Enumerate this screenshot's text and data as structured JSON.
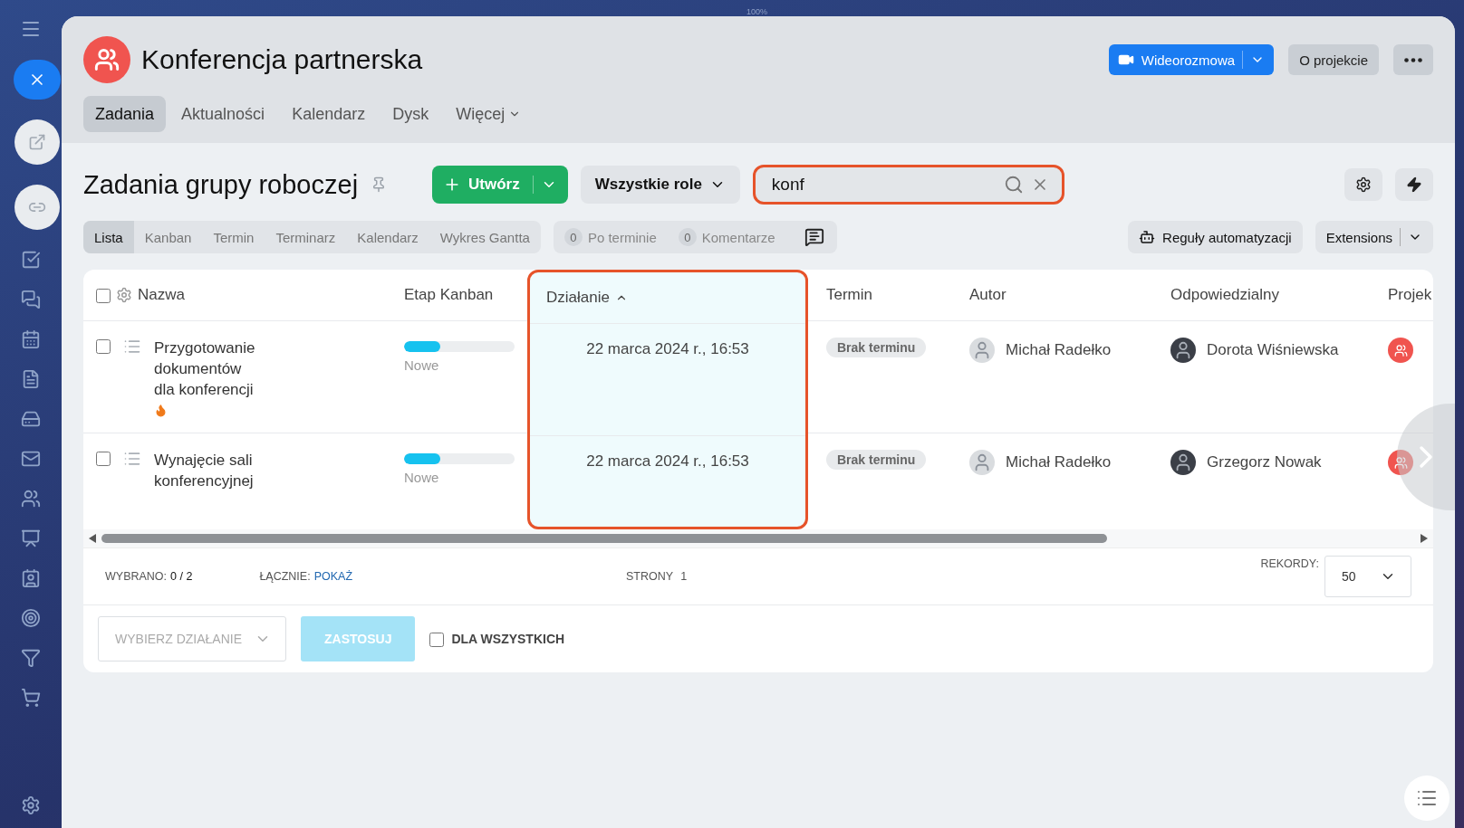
{
  "zoom_label": "100%",
  "project": {
    "title": "Konferencja partnerska"
  },
  "header_buttons": {
    "video": "Wideorozmowa",
    "about": "O projekcie"
  },
  "nav_tabs": [
    {
      "label": "Zadania",
      "selected": true,
      "kind": "link"
    },
    {
      "label": "Aktualności",
      "selected": false,
      "kind": "link"
    },
    {
      "label": "Kalendarz",
      "selected": false,
      "kind": "link"
    },
    {
      "label": "Dysk",
      "selected": false,
      "kind": "link"
    },
    {
      "label": "Więcej",
      "selected": false,
      "kind": "menu"
    }
  ],
  "page_title": "Zadania grupy roboczej",
  "create_button": "Utwórz",
  "role_filter": "Wszystkie role",
  "search": {
    "value": "konf",
    "highlighted": true
  },
  "views": [
    {
      "label": "Lista",
      "selected": true
    },
    {
      "label": "Kanban",
      "selected": false
    },
    {
      "label": "Termin",
      "selected": false
    },
    {
      "label": "Terminarz",
      "selected": false
    },
    {
      "label": "Kalendarz",
      "selected": false
    },
    {
      "label": "Wykres Gantta",
      "selected": false
    }
  ],
  "counters": [
    {
      "count": "0",
      "label": "Po terminie"
    },
    {
      "count": "0",
      "label": "Komentarze"
    }
  ],
  "automation_button": "Reguły automatyzacji",
  "extensions_button": "Extensions",
  "table": {
    "all_checked": false,
    "columns": [
      {
        "label": "Nazwa",
        "sorted": false,
        "highlighted": false
      },
      {
        "label": "Etap Kanban",
        "sorted": false,
        "highlighted": false
      },
      {
        "label": "Działanie",
        "sorted": true,
        "highlighted": true
      },
      {
        "label": "Termin",
        "sorted": false,
        "highlighted": false
      },
      {
        "label": "Autor",
        "sorted": false,
        "highlighted": false
      },
      {
        "label": "Odpowiedzialny",
        "sorted": false,
        "highlighted": false
      },
      {
        "label": "Projek",
        "sorted": false,
        "highlighted": false
      }
    ],
    "rows": [
      {
        "checked": false,
        "name": "Przygotowanie dokumentów dla konferencji",
        "hot": true,
        "stage": "Nowe",
        "level": 0.33,
        "activity": "22 marca 2024 r., 16:53",
        "deadline": "Brak terminu",
        "author": "Michał Radełko",
        "responsible": "Dorota Wiśniewska"
      },
      {
        "checked": false,
        "name": "Wynajęcie sali konferencyjnej",
        "hot": false,
        "stage": "Nowe",
        "level": 0.33,
        "activity": "22 marca 2024 r., 16:53",
        "deadline": "Brak terminu",
        "author": "Michał Radełko",
        "responsible": "Grzegorz Nowak"
      }
    ]
  },
  "footer": {
    "selected_label": "WYBRANO:",
    "selected_value": "0 / 2",
    "total_label": "ŁĄCZNIE:",
    "total_link": "POKAŻ",
    "pages_label": "STRONY",
    "pages_value": "1",
    "records_label": "REKORDY:",
    "records_value": "50"
  },
  "action_bar": {
    "action_placeholder": "WYBIERZ DZIAŁANIE",
    "apply_button": "ZASTOSUJ",
    "apply_disabled": true,
    "for_all": {
      "label": "DLA WSZYSTKICH",
      "checked": false
    }
  }
}
